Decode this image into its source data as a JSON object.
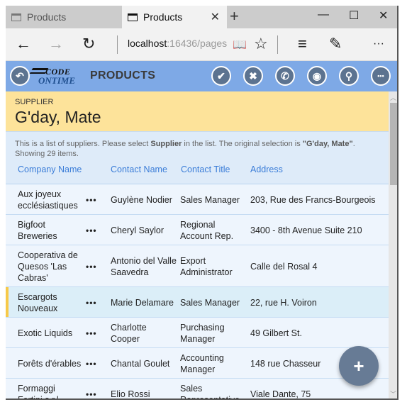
{
  "browser": {
    "tabs": [
      {
        "label": "Products",
        "active": false
      },
      {
        "label": "Products",
        "active": true
      }
    ],
    "new_tab_icon": "+",
    "window_controls": {
      "minimize": "—",
      "maximize": "☐",
      "close": "✕"
    },
    "url_host": "localhost",
    "url_rest": ":16436/pages",
    "icons": {
      "back": "←",
      "forward": "→",
      "refresh": "↻",
      "reading": "📖",
      "favorite": "☆",
      "hub": "≡",
      "note": "✎",
      "more": "···"
    }
  },
  "app": {
    "logo_line1": "CODE",
    "logo_line2": "ONTIME",
    "title": "PRODUCTS",
    "back_icon": "↶",
    "actions": [
      {
        "name": "check",
        "glyph": "✔"
      },
      {
        "name": "cancel",
        "glyph": "✖"
      },
      {
        "name": "phone",
        "glyph": "✆"
      },
      {
        "name": "view",
        "glyph": "◉"
      },
      {
        "name": "search",
        "glyph": "⚲"
      },
      {
        "name": "more",
        "glyph": "•••"
      }
    ]
  },
  "supplier": {
    "label": "SUPPLIER",
    "value": "G'day, Mate"
  },
  "info": {
    "text1": "This is a list of suppliers. Please select ",
    "bold1": "Supplier",
    "text2": " in the list. The original selection is ",
    "bold2": "\"G'day, Mate\"",
    "text3": ".",
    "line2": "Showing 29 items."
  },
  "columns": [
    "Company Name",
    "Contact Name",
    "Contact Title",
    "Address"
  ],
  "rows": [
    {
      "company": "Aux joyeux ecclésiastiques",
      "contact": "Guylène Nodier",
      "title": "Sales Manager",
      "address": "203, Rue des Francs-Bourgeois",
      "selected": false
    },
    {
      "company": "Bigfoot Breweries",
      "contact": "Cheryl Saylor",
      "title": "Regional Account Rep.",
      "address": "3400 - 8th Avenue Suite 210",
      "selected": false
    },
    {
      "company": "Cooperativa de Quesos 'Las Cabras'",
      "contact": "Antonio del Valle Saavedra",
      "title": "Export Administrator",
      "address": "Calle del Rosal 4",
      "selected": false
    },
    {
      "company": "Escargots Nouveaux",
      "contact": "Marie Delamare",
      "title": "Sales Manager",
      "address": "22, rue H. Voiron",
      "selected": true
    },
    {
      "company": "Exotic Liquids",
      "contact": "Charlotte Cooper",
      "title": "Purchasing Manager",
      "address": "49 Gilbert St.",
      "selected": false
    },
    {
      "company": "Forêts d'érables",
      "contact": "Chantal Goulet",
      "title": "Accounting Manager",
      "address": "148 rue Chasseur",
      "selected": false
    },
    {
      "company": "Formaggi Fortini s.r.l.",
      "contact": "Elio Rossi",
      "title": "Sales Representative",
      "address": "Viale Dante, 75",
      "selected": false
    }
  ],
  "row_menu_glyph": "•••",
  "fab_glyph": "+"
}
